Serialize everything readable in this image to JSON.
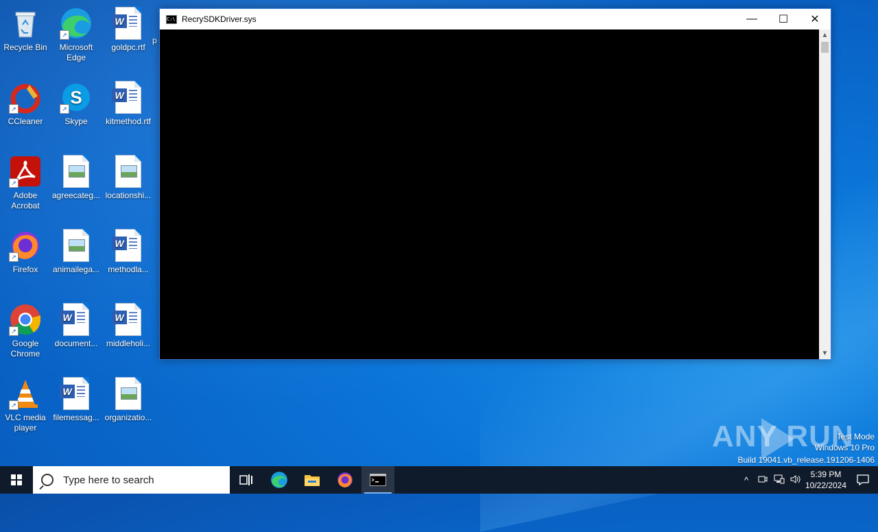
{
  "desktop": {
    "icons": [
      {
        "label": "Recycle Bin"
      },
      {
        "label": "Microsoft Edge"
      },
      {
        "label": "goldpc.rtf"
      },
      {
        "label": "CCleaner"
      },
      {
        "label": "Skype"
      },
      {
        "label": "kitmethod.rtf"
      },
      {
        "label": "Adobe Acrobat"
      },
      {
        "label": "agreecateg..."
      },
      {
        "label": "locationshi..."
      },
      {
        "label": "Firefox"
      },
      {
        "label": "animailega..."
      },
      {
        "label": "methodla..."
      },
      {
        "label": "Google Chrome"
      },
      {
        "label": "document..."
      },
      {
        "label": "middleholi..."
      },
      {
        "label": "VLC media player"
      },
      {
        "label": "filemessag..."
      },
      {
        "label": "organizatio..."
      }
    ],
    "partial_label": "p"
  },
  "window": {
    "title": "RecrySDKDriver.sys",
    "icon": "cmd-console-icon",
    "minimize": "—",
    "maximize": "☐",
    "close": "✕"
  },
  "watermark": {
    "brand": "ANY RUN",
    "line1": "Test Mode",
    "line2": "Windows 10 Pro",
    "line3": "Build 19041.vb_release.191206-1406"
  },
  "taskbar": {
    "search_placeholder": "Type here to search",
    "apps": [
      "task-view-icon",
      "edge-icon",
      "file-explorer-icon",
      "firefox-icon",
      "cmd-icon"
    ],
    "tray": {
      "chevron": "^",
      "time": "5:39 PM",
      "date": "10/22/2024"
    }
  }
}
